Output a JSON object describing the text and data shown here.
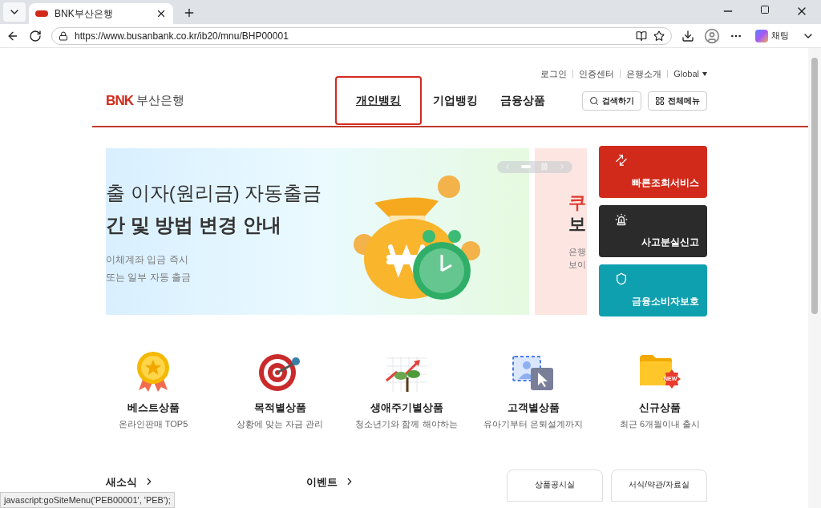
{
  "browser": {
    "tabs": [
      {
        "title": "BNK부산은행",
        "selected": true
      }
    ],
    "url": "https://www.busanbank.co.kr/ib20/mnu/BHP00001",
    "chat_label": "채팅"
  },
  "header": {
    "logo_mark": "BNK",
    "logo_text": "부산은행",
    "util_links": [
      "로그인",
      "인증센터",
      "은행소개",
      "Global"
    ],
    "nav": [
      {
        "label": "개인뱅킹",
        "highlighted": true
      },
      {
        "label": "기업뱅킹",
        "highlighted": false
      },
      {
        "label": "금융상품",
        "highlighted": false
      }
    ],
    "buttons": [
      {
        "kind": "search",
        "label": "검색하기"
      },
      {
        "kind": "menu",
        "label": "전체메뉴"
      }
    ]
  },
  "banner": {
    "title_line_1": "출 이자(원리금) 자동출금",
    "title_line_2": "간 및 방법 변경 안내",
    "desc_line_1": "이체계좌 입금 즉시",
    "desc_line_2": "또는 일부 자동 출금",
    "next_title_1": "쿠",
    "next_title_2": "보",
    "next_desc_1": "은행",
    "next_desc_2": "보이"
  },
  "quick_services": [
    {
      "kind": "arrows",
      "label": "빠른조회서비스",
      "color": "#d12a1a"
    },
    {
      "kind": "siren",
      "label": "사고분실신고",
      "color": "#2b2b2b"
    },
    {
      "kind": "shield",
      "label": "금융소비자보호",
      "color": "#0fa0b0"
    }
  ],
  "categories": [
    {
      "kind": "medal",
      "title": "베스트상품",
      "subtitle": "온라인판매 TOP5"
    },
    {
      "kind": "target",
      "title": "목적별상품",
      "subtitle": "상황에 맞는 자금 관리"
    },
    {
      "kind": "growth",
      "title": "생애주기별상품",
      "subtitle": "청소년기와 함께 해야하는"
    },
    {
      "kind": "profile",
      "title": "고객별상품",
      "subtitle": "유아기부터 은퇴설계까지"
    },
    {
      "kind": "folder",
      "title": "신규상품",
      "subtitle": "최근 6개월이내 출시",
      "badge": "NEW"
    }
  ],
  "bottom": {
    "news": "새소식",
    "events": "이벤트",
    "buttons": [
      "상품공시실",
      "서식/약관/자료실"
    ]
  },
  "status_bar": "javascript:goSiteMenu('PEB00001', 'PEB');"
}
